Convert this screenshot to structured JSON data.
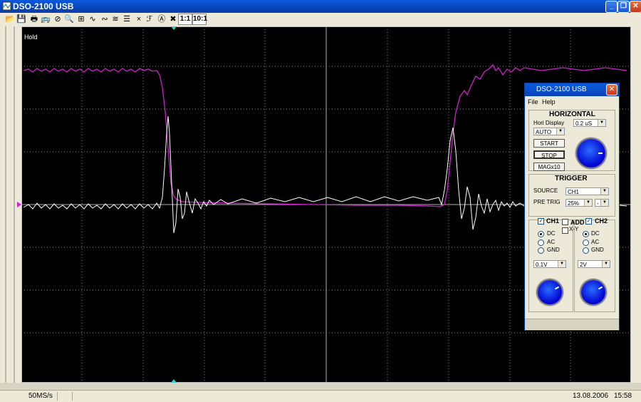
{
  "window": {
    "title": "DSO-2100 USB"
  },
  "toolbar": {
    "ratio_1": "1:1",
    "ratio_10": "10:1"
  },
  "scope": {
    "hold_label": "Hold"
  },
  "status": {
    "sample_rate": "50MS/s",
    "date": "13.08.2006",
    "time": "15:58"
  },
  "panel": {
    "title": "DSO-2100 USB",
    "menu": [
      "File",
      "Help"
    ],
    "horizontal": {
      "header": "HORIZONTAL",
      "hori_display_label": "Hori Display",
      "timebase": "0.2 uS",
      "mode": "AUTO",
      "start_label": "START",
      "stop_label": "STOP",
      "mag_label": "MAGx10"
    },
    "trigger": {
      "header": "TRIGGER",
      "source_label": "SOURCE",
      "source": "CH1",
      "pretrig_label": "PRE TRIG",
      "pretrig": "25%",
      "slope": "-"
    },
    "channels": {
      "ch1_label": "CH1",
      "add_label": "ADD",
      "xy_label": "X-Y",
      "ch2_label": "CH2",
      "ch1_coupling": [
        "DC",
        "AC",
        "GND"
      ],
      "ch2_coupling": [
        "DC",
        "AC",
        "GND"
      ],
      "ch1_volts": "0.1V",
      "ch2_volts": "2V"
    }
  },
  "colors": {
    "ch1": "#ffffff",
    "ch2": "#d020d0",
    "grid": "#8a8a8a",
    "accent": "#0a5ade"
  }
}
